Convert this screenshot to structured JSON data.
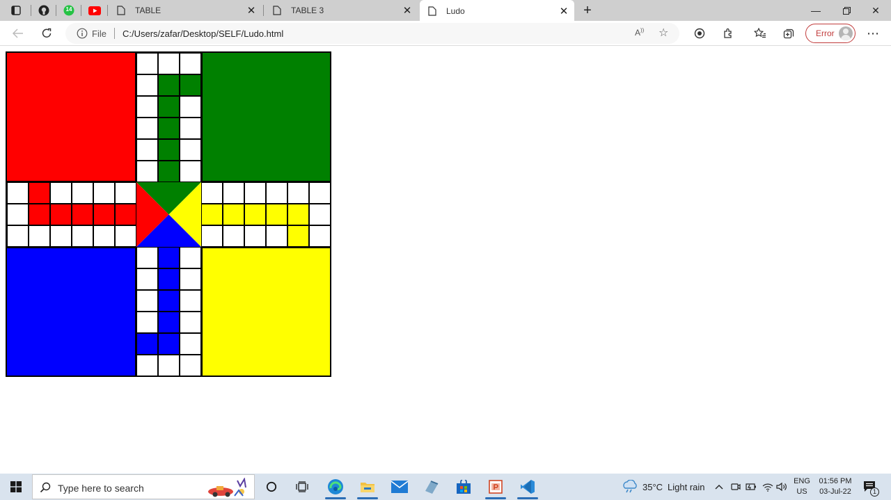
{
  "browser": {
    "tabs": [
      {
        "label": "TABLE"
      },
      {
        "label": "TABLE 3"
      },
      {
        "label": "Ludo"
      }
    ],
    "whatsapp_badge": "14",
    "address": {
      "file_label": "File",
      "url": "C:/Users/zafar/Desktop/SELF/Ludo.html"
    },
    "profile_label": "Error"
  },
  "board": {
    "colors": {
      "red": "#ff0000",
      "green": "#008000",
      "yellow": "#ffff00",
      "blue": "#0000ff",
      "cell": "#ffffff",
      "border": "#000000"
    }
  },
  "taskbar": {
    "search_placeholder": "Type here to search",
    "weather_temp": "35°C",
    "weather_text": "Light rain",
    "lang_top": "ENG",
    "lang_bottom": "US",
    "time": "01:56 PM",
    "date": "03-Jul-22",
    "notification_count": "1"
  }
}
